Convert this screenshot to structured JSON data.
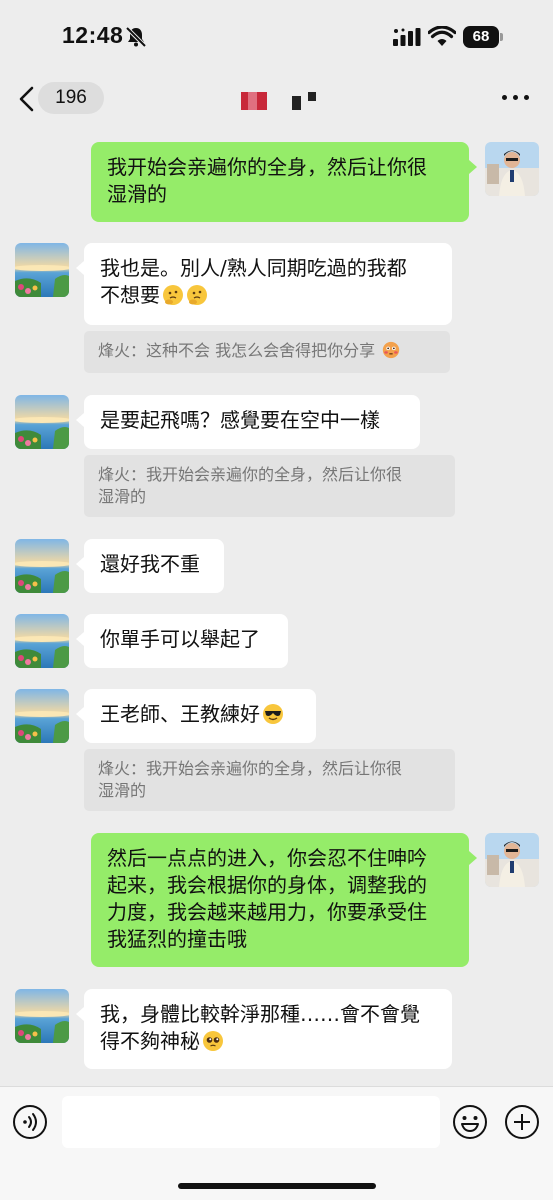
{
  "status_bar": {
    "time": "12:48",
    "battery": "68"
  },
  "header": {
    "unread_count": "196"
  },
  "messages": [
    {
      "side": "out",
      "text": "我开始会亲遍你的全身，然后让你很\n湿滑的"
    },
    {
      "side": "in",
      "text": "我也是。別人/熟人同期吃過的我都\n不想要",
      "emoji": "thinking-face x2"
    },
    {
      "quote": "烽火：这种不会 我怎么会舍得把你分享",
      "emoji": "flushed-face"
    },
    {
      "side": "in",
      "text": "是要起飛嗎？感覺要在空中一樣"
    },
    {
      "quote": "烽火：我开始会亲遍你的全身，然后让你很\n湿滑的"
    },
    {
      "side": "in",
      "text": "還好我不重"
    },
    {
      "side": "in",
      "text": "你單手可以舉起了"
    },
    {
      "side": "in",
      "text": "王老師、王教練好",
      "emoji": "sunglasses-face"
    },
    {
      "quote": "烽火：我开始会亲遍你的全身，然后让你很\n湿滑的"
    },
    {
      "side": "out",
      "text": "然后一点点的进入，你会忍不住呻吟\n起来，我会根据你的身体，调整我的\n力度，我会越来越用力，你要承受住\n我猛烈的撞击哦"
    },
    {
      "side": "in",
      "text": "我，身體比較幹淨那種……會不會覺\n得不夠神秘",
      "emoji": "pleading-face"
    }
  ],
  "input": {
    "value": ""
  },
  "colors": {
    "out_bubble": "#95ec69",
    "in_bubble": "#ffffff",
    "background": "#ededed",
    "quote": "#e2e2e2"
  }
}
